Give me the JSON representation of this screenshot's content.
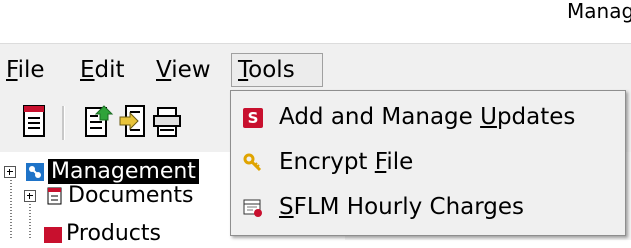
{
  "window": {
    "title": "Manag"
  },
  "menubar": {
    "items": [
      {
        "label_pre": "",
        "mnemonic": "F",
        "label_post": "ile"
      },
      {
        "label_pre": "",
        "mnemonic": "E",
        "label_post": "dit"
      },
      {
        "label_pre": "",
        "mnemonic": "V",
        "label_post": "iew"
      },
      {
        "label_pre": "",
        "mnemonic": "T",
        "label_post": "ools"
      }
    ]
  },
  "tools_menu": {
    "items": [
      {
        "icon": "sflm-s-icon",
        "label_pre": "Add and Manage ",
        "mnemonic": "U",
        "label_post": "pdates"
      },
      {
        "icon": "encrypt-key-icon",
        "label_pre": "Encrypt ",
        "mnemonic": "F",
        "label_post": "ile"
      },
      {
        "icon": "hourly-charges-icon",
        "label_pre": "",
        "mnemonic": "S",
        "label_post": "FLM Hourly Charges"
      }
    ]
  },
  "tree": {
    "nodes": [
      {
        "label": "Management"
      },
      {
        "label": "Documents"
      },
      {
        "label": "Products"
      }
    ]
  },
  "colors": {
    "selection": "#000000",
    "menu_bg": "#f0f0f0",
    "accent_red": "#c8102e"
  }
}
